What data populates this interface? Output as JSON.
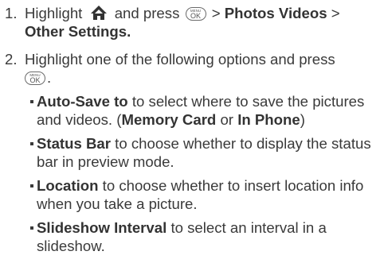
{
  "menu_key": {
    "top": "MENU",
    "bottom": "OK"
  },
  "step1": {
    "number": "1.",
    "text_a": "Highlight",
    "text_b": "and press",
    "path_sep1": ">",
    "path_item1": "Photos Videos",
    "path_sep2": ">",
    "path_item2": "Other Settings."
  },
  "step2": {
    "number": "2.",
    "text": "Highlight one of the following options and press",
    "end": "."
  },
  "options": [
    {
      "term": "Auto-Save to",
      "desc": "to select where to save the pictures"
    },
    {
      "term": "Status Bar",
      "desc": "to choose whether to display the status"
    },
    {
      "term": "Location",
      "desc": "to choose whether to insert location info"
    },
    {
      "term": "Slideshow Interval",
      "desc": "to select an interval in a"
    }
  ],
  "option0_cont": {
    "a": "and videos. (",
    "b": "Memory Card",
    "c": "or",
    "d": "In Phone",
    "e": ")"
  },
  "option1_cont": "bar in preview mode.",
  "option2_cont": "when you take a picture.",
  "option3_cont": "slideshow."
}
